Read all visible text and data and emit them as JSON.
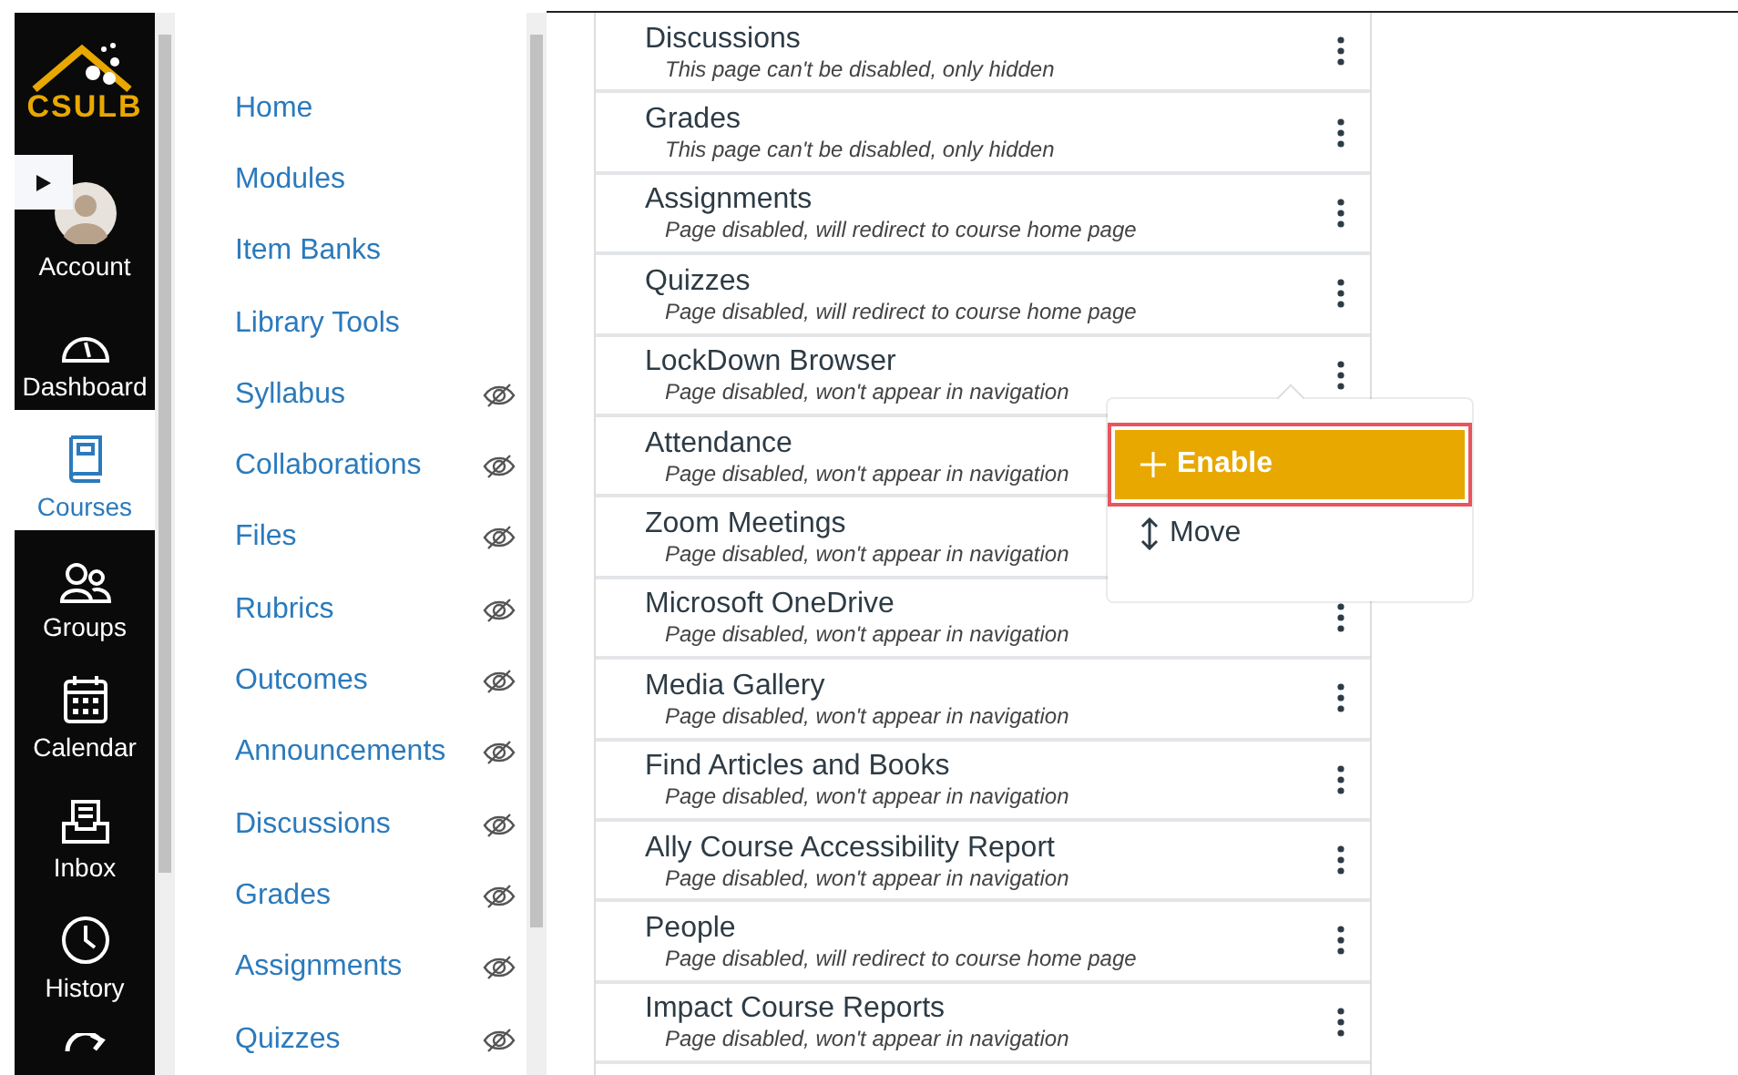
{
  "global_nav": {
    "logo": "CSULB",
    "items": [
      {
        "label": "Account",
        "kind": "avatar",
        "selected": false
      },
      {
        "label": "Dashboard",
        "kind": "dashboard",
        "selected": false
      },
      {
        "label": "Courses",
        "kind": "courses",
        "selected": true
      },
      {
        "label": "Groups",
        "kind": "groups",
        "selected": false
      },
      {
        "label": "Calendar",
        "kind": "calendar",
        "selected": false
      },
      {
        "label": "Inbox",
        "kind": "inbox",
        "selected": false
      },
      {
        "label": "History",
        "kind": "history",
        "selected": false
      }
    ]
  },
  "course_nav": {
    "items": [
      {
        "label": "Home",
        "hidden": false
      },
      {
        "label": "Modules",
        "hidden": false
      },
      {
        "label": "Item Banks",
        "hidden": false
      },
      {
        "label": "Library Tools",
        "hidden": false
      },
      {
        "label": "Syllabus",
        "hidden": true
      },
      {
        "label": "Collaborations",
        "hidden": true
      },
      {
        "label": "Files",
        "hidden": true
      },
      {
        "label": "Rubrics",
        "hidden": true
      },
      {
        "label": "Outcomes",
        "hidden": true
      },
      {
        "label": "Announcements",
        "hidden": true
      },
      {
        "label": "Discussions",
        "hidden": true
      },
      {
        "label": "Grades",
        "hidden": true
      },
      {
        "label": "Assignments",
        "hidden": true
      },
      {
        "label": "Quizzes",
        "hidden": true
      }
    ]
  },
  "pages": [
    {
      "name": "Discussions",
      "note": "This page can't be disabled, only hidden"
    },
    {
      "name": "Grades",
      "note": "This page can't be disabled, only hidden"
    },
    {
      "name": "Assignments",
      "note": "Page disabled, will redirect to course home page"
    },
    {
      "name": "Quizzes",
      "note": "Page disabled, will redirect to course home page"
    },
    {
      "name": "LockDown Browser",
      "note": "Page disabled, won't appear in navigation"
    },
    {
      "name": "Attendance",
      "note": "Page disabled, won't appear in navigation"
    },
    {
      "name": "Zoom Meetings",
      "note": "Page disabled, won't appear in navigation"
    },
    {
      "name": "Microsoft OneDrive",
      "note": "Page disabled, won't appear in navigation"
    },
    {
      "name": "Media Gallery",
      "note": "Page disabled, won't appear in navigation"
    },
    {
      "name": "Find Articles and Books",
      "note": "Page disabled, won't appear in navigation"
    },
    {
      "name": "Ally Course Accessibility Report",
      "note": "Page disabled, won't appear in navigation"
    },
    {
      "name": "People",
      "note": "Page disabled, will redirect to course home page"
    },
    {
      "name": "Impact Course Reports",
      "note": "Page disabled, won't appear in navigation"
    }
  ],
  "menu": {
    "items": [
      {
        "label": "Enable",
        "kind": "enable",
        "selected": true
      },
      {
        "label": "Move",
        "kind": "move",
        "selected": false
      }
    ]
  }
}
